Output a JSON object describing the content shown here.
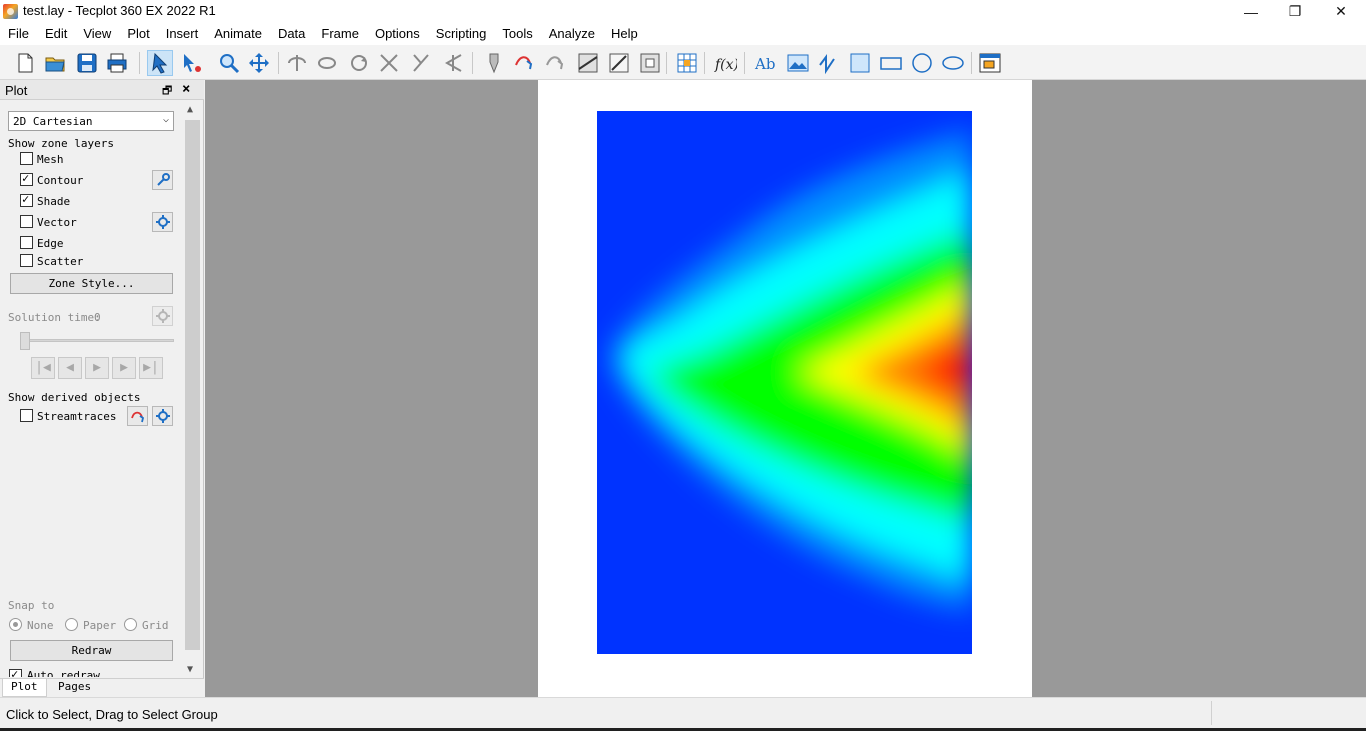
{
  "window": {
    "title": "test.lay - Tecplot 360 EX 2022 R1",
    "minimize": "—",
    "restore": "❐",
    "close": "✕"
  },
  "menu": [
    "File",
    "Edit",
    "View",
    "Plot",
    "Insert",
    "Animate",
    "Data",
    "Frame",
    "Options",
    "Scripting",
    "Tools",
    "Analyze",
    "Help"
  ],
  "panel": {
    "title": "Plot",
    "plot_type": "2D Cartesian",
    "show_zone_layers": "Show zone layers",
    "layers": [
      {
        "label": "Mesh",
        "checked": false
      },
      {
        "label": "Contour",
        "checked": true
      },
      {
        "label": "Shade",
        "checked": true
      },
      {
        "label": "Vector",
        "checked": false
      },
      {
        "label": "Edge",
        "checked": false
      },
      {
        "label": "Scatter",
        "checked": false
      }
    ],
    "zone_style_button": "Zone Style...",
    "solution_time_label": "Solution time:",
    "solution_time_value": "0",
    "show_derived_objects": "Show derived objects",
    "streamtraces": {
      "label": "Streamtraces",
      "checked": false
    },
    "snap_to": "Snap to",
    "snap_options": [
      {
        "label": "None",
        "selected": true
      },
      {
        "label": "Paper",
        "selected": false
      },
      {
        "label": "Grid",
        "selected": false
      }
    ],
    "redraw_button": "Redraw",
    "auto_redraw": {
      "label": "Auto redraw",
      "checked": true
    },
    "tabs": [
      "Plot",
      "Pages"
    ]
  },
  "status": {
    "message": "Click to Select, Drag to Select Group"
  },
  "colors": {
    "workspace": "#999999",
    "paper": "#ffffff",
    "contour_low": "#0033ff",
    "contour_mid": "#00ff00",
    "contour_high": "#ff0000"
  }
}
